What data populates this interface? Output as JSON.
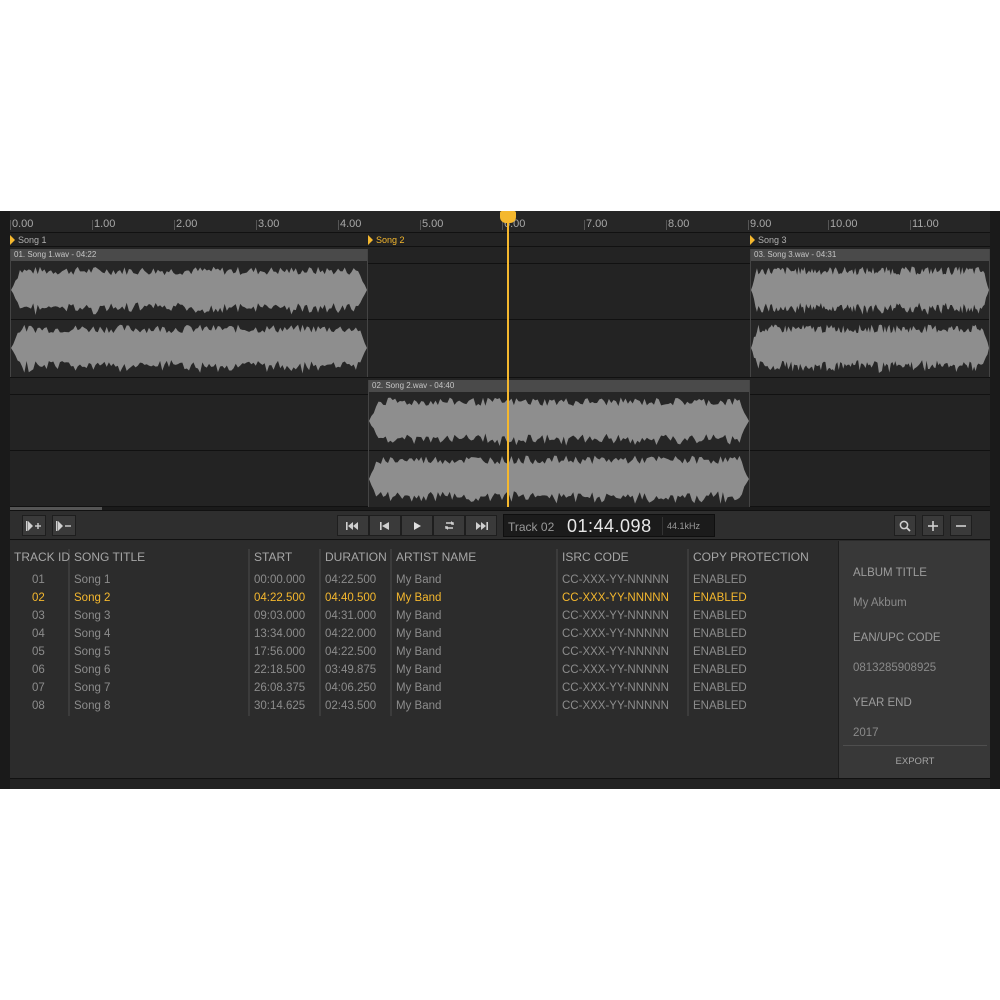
{
  "ruler": {
    "ticks": [
      "0.00",
      "1.00",
      "2.00",
      "3.00",
      "4.00",
      "5.00",
      "6.00",
      "7.00",
      "8.00",
      "9.00",
      "10.00",
      "11.00"
    ]
  },
  "markers": [
    {
      "label": "Song 1"
    },
    {
      "label": "Song 2"
    },
    {
      "label": "Song 3"
    }
  ],
  "clips": [
    {
      "title": "01. Song 1.wav - 04:22"
    },
    {
      "title": "02. Song 2.wav - 04:40"
    },
    {
      "title": "03. Song 3.wav - 04:31"
    }
  ],
  "transport": {
    "track": "Track 02",
    "time": "01:44.098",
    "rate": "44.1kHz"
  },
  "table": {
    "headers": {
      "track_id": "TRACK ID",
      "title": "SONG TITLE",
      "start": "START",
      "duration": "DURATION",
      "artist": "ARTIST NAME",
      "isrc": "ISRC CODE",
      "protection": "COPY PROTECTION"
    },
    "rows": [
      {
        "id": "01",
        "title": "Song 1",
        "start": "00:00.000",
        "duration": "04:22.500",
        "artist": "My Band",
        "isrc": "CC-XXX-YY-NNNNN",
        "protection": "ENABLED"
      },
      {
        "id": "02",
        "title": "Song 2",
        "start": "04:22.500",
        "duration": "04:40.500",
        "artist": "My Band",
        "isrc": "CC-XXX-YY-NNNNN",
        "protection": "ENABLED"
      },
      {
        "id": "03",
        "title": "Song 3",
        "start": "09:03.000",
        "duration": "04:31.000",
        "artist": "My Band",
        "isrc": "CC-XXX-YY-NNNNN",
        "protection": "ENABLED"
      },
      {
        "id": "04",
        "title": "Song 4",
        "start": "13:34.000",
        "duration": "04:22.000",
        "artist": "My Band",
        "isrc": "CC-XXX-YY-NNNNN",
        "protection": "ENABLED"
      },
      {
        "id": "05",
        "title": "Song 5",
        "start": "17:56.000",
        "duration": "04:22.500",
        "artist": "My Band",
        "isrc": "CC-XXX-YY-NNNNN",
        "protection": "ENABLED"
      },
      {
        "id": "06",
        "title": "Song 6",
        "start": "22:18.500",
        "duration": "03:49.875",
        "artist": "My Band",
        "isrc": "CC-XXX-YY-NNNNN",
        "protection": "ENABLED"
      },
      {
        "id": "07",
        "title": "Song 7",
        "start": "26:08.375",
        "duration": "04:06.250",
        "artist": "My Band",
        "isrc": "CC-XXX-YY-NNNNN",
        "protection": "ENABLED"
      },
      {
        "id": "08",
        "title": "Song 8",
        "start": "30:14.625",
        "duration": "02:43.500",
        "artist": "My Band",
        "isrc": "CC-XXX-YY-NNNNN",
        "protection": "ENABLED"
      }
    ]
  },
  "sidebar": {
    "album_title_label": "ALBUM TITLE",
    "album_title_value": "My Akbum",
    "ean_label": "EAN/UPC CODE",
    "ean_value": "0813285908925",
    "year_label": "YEAR END",
    "year_value": "2017",
    "export_label": "EXPORT"
  },
  "colors": {
    "accent": "#f5b82e",
    "background": "#2b2b2b",
    "waveform": "#8e8e8e"
  },
  "icons": {
    "add_marker": "add-marker-icon",
    "remove_marker": "remove-marker-icon",
    "skip_back": "skip-to-start-icon",
    "prev": "previous-track-icon",
    "play": "play-icon",
    "loop": "loop-icon",
    "skip_forward": "skip-to-end-icon",
    "zoom": "search-icon",
    "zoom_in": "plus-icon",
    "zoom_out": "minus-icon"
  }
}
